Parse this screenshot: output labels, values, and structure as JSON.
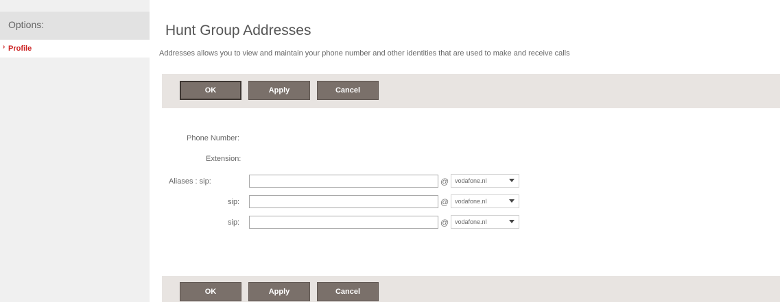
{
  "sidebar": {
    "header": "Options:",
    "items": [
      {
        "chevron": "›",
        "label": "Profile"
      }
    ]
  },
  "main": {
    "title": "Hunt Group Addresses",
    "description": "Addresses allows you to view and maintain your phone number and other identities that are used to make and receive calls"
  },
  "buttons": {
    "ok": "OK",
    "apply": "Apply",
    "cancel": "Cancel"
  },
  "form": {
    "phone_number_label": "Phone Number:",
    "extension_label": "Extension:",
    "aliases_label": "Aliases : sip:",
    "sip_label": "sip:",
    "at_symbol": "@",
    "aliases": [
      {
        "value": "",
        "domain": "vodafone.nl"
      },
      {
        "value": "",
        "domain": "vodafone.nl"
      },
      {
        "value": "",
        "domain": "vodafone.nl"
      }
    ]
  },
  "colors": {
    "accent": "#cc2222",
    "button_bg": "#7a706a",
    "bar_bg": "#e8e4e1",
    "sidebar_bg": "#f0f0f0"
  }
}
